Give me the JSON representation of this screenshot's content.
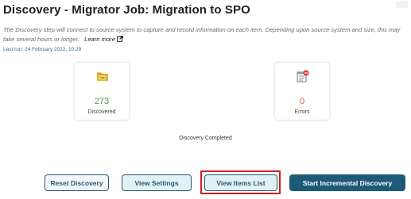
{
  "header": {
    "title": "Discovery - Migrator Job: Migration to SPO"
  },
  "intro": {
    "description": "The Discovery step will connect to source system to capture and record information on each item. Depending upon source system and size, this may take several hours or longer.",
    "learn_more": "Learn more",
    "last_run": "Last run: 24 February 2022, 10:29"
  },
  "stats": {
    "discovered": {
      "count": "273",
      "label": "Discovered",
      "icon": "folder-icon"
    },
    "errors": {
      "count": "0",
      "label": "Errors",
      "icon": "error-document-icon"
    }
  },
  "status_text": "Discovery Completed",
  "actions": {
    "reset": "Reset Discovery",
    "settings": "View Settings",
    "items_list": "View Items List",
    "incremental": "Start Incremental Discovery"
  },
  "colors": {
    "primary": "#1d5a78",
    "success": "#43a047",
    "error": "#e5533d",
    "highlight": "#d21f1f"
  }
}
